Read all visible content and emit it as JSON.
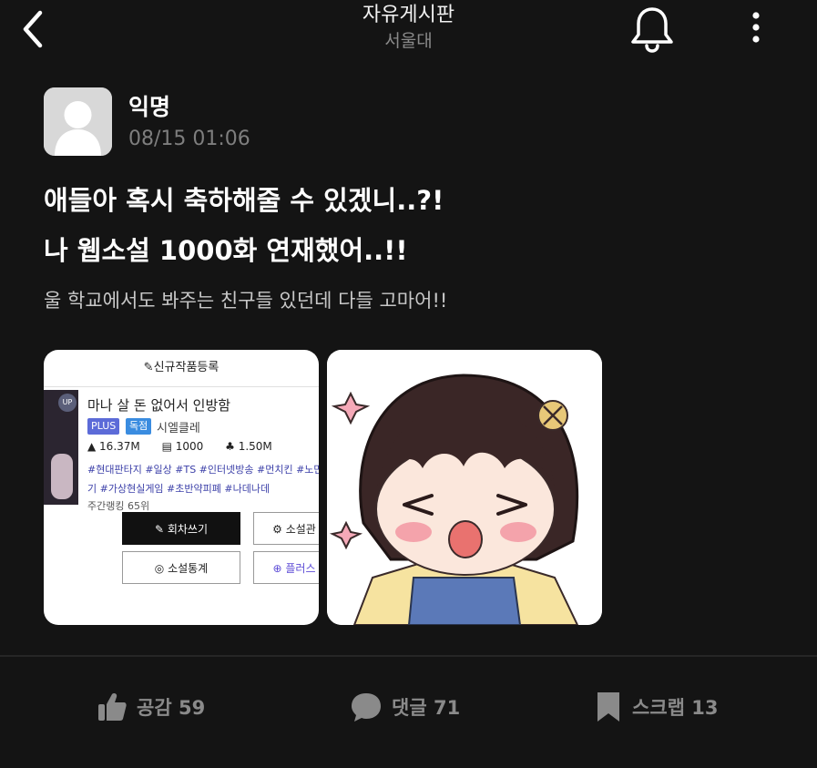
{
  "header": {
    "title": "자유게시판",
    "subtitle": "서울대",
    "icons": {
      "back": "chevron-left-icon",
      "notify": "bell-icon",
      "more": "more-vertical-icon"
    }
  },
  "post": {
    "author": "익명",
    "time": "08/15 01:06",
    "title_lines": [
      "애들아 혹시 축하해줄 수 있겠니..?!",
      "나 웹소설 1000화 연재했어..!!"
    ],
    "body": "울 학교에서도 봐주는 친구들 있던데 다들 고마어!!",
    "images": {
      "screenshot": {
        "header": "✎신규작품등록",
        "badge": "UP",
        "novel_title": "마나 살 돈 없어서 인방함",
        "tags_badges": [
          "PLUS",
          "독점"
        ],
        "author": "시엘클레",
        "views": "16.37M",
        "episodes": "1000",
        "recommends": "1.50M",
        "tags_lines": [
          "#현대판타지 #일상 #TS #인터넷방송 #먼치킨 #노만",
          "기 #가상현실게임 #초반약피폐 #나데나데"
        ],
        "rank": "주간랭킹 65위",
        "buttons": {
          "write": "회차쓰기",
          "manage": "소설관",
          "stats": "소설통계",
          "plus": "플러스"
        }
      },
      "sticker": {
        "icon": "anime-girl-sticker"
      }
    }
  },
  "actions": {
    "like": {
      "label": "공감 59",
      "icon": "thumbs-up-icon"
    },
    "comment": {
      "label": "댓글 71",
      "icon": "comment-icon"
    },
    "scrap": {
      "label": "스크랩 13",
      "icon": "bookmark-icon"
    }
  },
  "colors": {
    "background": "#141414",
    "text": "#ffffff",
    "muted": "#8a8a8a"
  }
}
